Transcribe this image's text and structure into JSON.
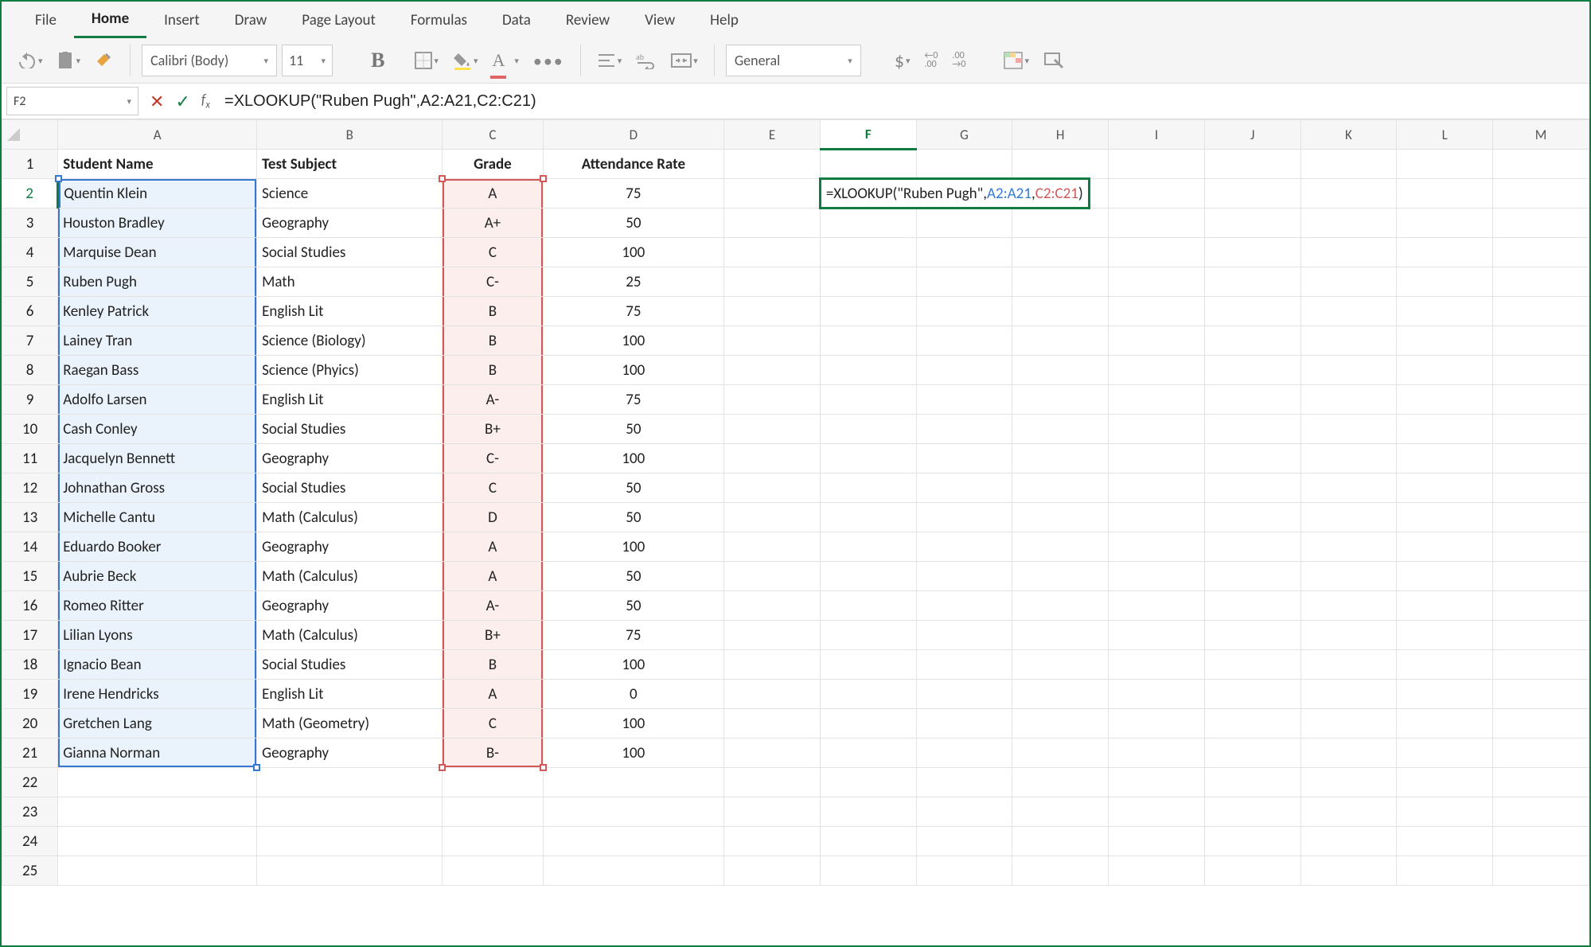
{
  "ribbon": {
    "tabs": [
      "File",
      "Home",
      "Insert",
      "Draw",
      "Page Layout",
      "Formulas",
      "Data",
      "Review",
      "View",
      "Help"
    ],
    "active_index": 1
  },
  "toolbar": {
    "font_name": "Calibri (Body)",
    "font_size": "11",
    "number_format": "General",
    "inc_decimal_label": ".00",
    "dec_decimal_label": ".00"
  },
  "formula_bar": {
    "name_box": "F2",
    "formula_text": "=XLOOKUP(\"Ruben Pugh\",A2:A21,C2:C21)",
    "formula_tokens": {
      "p1": "=XLOOKUP(\"Ruben Pugh\",",
      "p2": "A2:A21",
      "p3": ",",
      "p4": "C2:C21",
      "p5": ")"
    }
  },
  "columns": [
    "A",
    "B",
    "C",
    "D",
    "E",
    "F",
    "G",
    "H",
    "I",
    "J",
    "K",
    "L",
    "M"
  ],
  "active_col": "F",
  "active_row": 2,
  "headers": {
    "A": "Student Name",
    "B": "Test Subject",
    "C": "Grade",
    "D": "Attendance Rate"
  },
  "rows": [
    {
      "n": 2,
      "A": "Quentin Klein",
      "B": "Science",
      "C": "A",
      "D": "75"
    },
    {
      "n": 3,
      "A": "Houston Bradley",
      "B": "Geography",
      "C": "A+",
      "D": "50"
    },
    {
      "n": 4,
      "A": "Marquise Dean",
      "B": "Social Studies",
      "C": "C",
      "D": "100"
    },
    {
      "n": 5,
      "A": "Ruben Pugh",
      "B": "Math",
      "C": "C-",
      "D": "25"
    },
    {
      "n": 6,
      "A": "Kenley Patrick",
      "B": "English Lit",
      "C": "B",
      "D": "75"
    },
    {
      "n": 7,
      "A": "Lainey Tran",
      "B": "Science (Biology)",
      "C": "B",
      "D": "100"
    },
    {
      "n": 8,
      "A": "Raegan Bass",
      "B": "Science (Phyics)",
      "C": "B",
      "D": "100"
    },
    {
      "n": 9,
      "A": "Adolfo Larsen",
      "B": "English Lit",
      "C": "A-",
      "D": "75"
    },
    {
      "n": 10,
      "A": "Cash Conley",
      "B": "Social Studies",
      "C": "B+",
      "D": "50"
    },
    {
      "n": 11,
      "A": "Jacquelyn Bennett",
      "B": "Geography",
      "C": "C-",
      "D": "100"
    },
    {
      "n": 12,
      "A": "Johnathan Gross",
      "B": "Social Studies",
      "C": "C",
      "D": "50"
    },
    {
      "n": 13,
      "A": "Michelle Cantu",
      "B": "Math (Calculus)",
      "C": "D",
      "D": "50"
    },
    {
      "n": 14,
      "A": "Eduardo Booker",
      "B": "Geography",
      "C": "A",
      "D": "100"
    },
    {
      "n": 15,
      "A": "Aubrie Beck",
      "B": "Math (Calculus)",
      "C": "A",
      "D": "50"
    },
    {
      "n": 16,
      "A": "Romeo Ritter",
      "B": "Geography",
      "C": "A-",
      "D": "50"
    },
    {
      "n": 17,
      "A": "Lilian Lyons",
      "B": "Math (Calculus)",
      "C": "B+",
      "D": "75"
    },
    {
      "n": 18,
      "A": "Ignacio Bean",
      "B": "Social Studies",
      "C": "B",
      "D": "100"
    },
    {
      "n": 19,
      "A": "Irene Hendricks",
      "B": "English Lit",
      "C": "A",
      "D": "0"
    },
    {
      "n": 20,
      "A": "Gretchen Lang",
      "B": "Math (Geometry)",
      "C": "C",
      "D": "100"
    },
    {
      "n": 21,
      "A": "Gianna Norman",
      "B": "Geography",
      "C": "B-",
      "D": "100"
    }
  ],
  "empty_rows": [
    22,
    23,
    24,
    25
  ],
  "chart_data": {
    "type": "table",
    "title": "",
    "columns": [
      "Student Name",
      "Test Subject",
      "Grade",
      "Attendance Rate"
    ],
    "records": [
      [
        "Quentin Klein",
        "Science",
        "A",
        75
      ],
      [
        "Houston Bradley",
        "Geography",
        "A+",
        50
      ],
      [
        "Marquise Dean",
        "Social Studies",
        "C",
        100
      ],
      [
        "Ruben Pugh",
        "Math",
        "C-",
        25
      ],
      [
        "Kenley Patrick",
        "English Lit",
        "B",
        75
      ],
      [
        "Lainey Tran",
        "Science (Biology)",
        "B",
        100
      ],
      [
        "Raegan Bass",
        "Science (Phyics)",
        "B",
        100
      ],
      [
        "Adolfo Larsen",
        "English Lit",
        "A-",
        75
      ],
      [
        "Cash Conley",
        "Social Studies",
        "B+",
        50
      ],
      [
        "Jacquelyn Bennett",
        "Geography",
        "C-",
        100
      ],
      [
        "Johnathan Gross",
        "Social Studies",
        "C",
        50
      ],
      [
        "Michelle Cantu",
        "Math (Calculus)",
        "D",
        50
      ],
      [
        "Eduardo Booker",
        "Geography",
        "A",
        100
      ],
      [
        "Aubrie Beck",
        "Math (Calculus)",
        "A",
        50
      ],
      [
        "Romeo Ritter",
        "Geography",
        "A-",
        50
      ],
      [
        "Lilian Lyons",
        "Math (Calculus)",
        "B+",
        75
      ],
      [
        "Ignacio Bean",
        "Social Studies",
        "B",
        100
      ],
      [
        "Irene Hendricks",
        "English Lit",
        "A",
        0
      ],
      [
        "Gretchen Lang",
        "Math (Geometry)",
        "C",
        100
      ],
      [
        "Gianna Norman",
        "Geography",
        "B-",
        100
      ]
    ]
  }
}
